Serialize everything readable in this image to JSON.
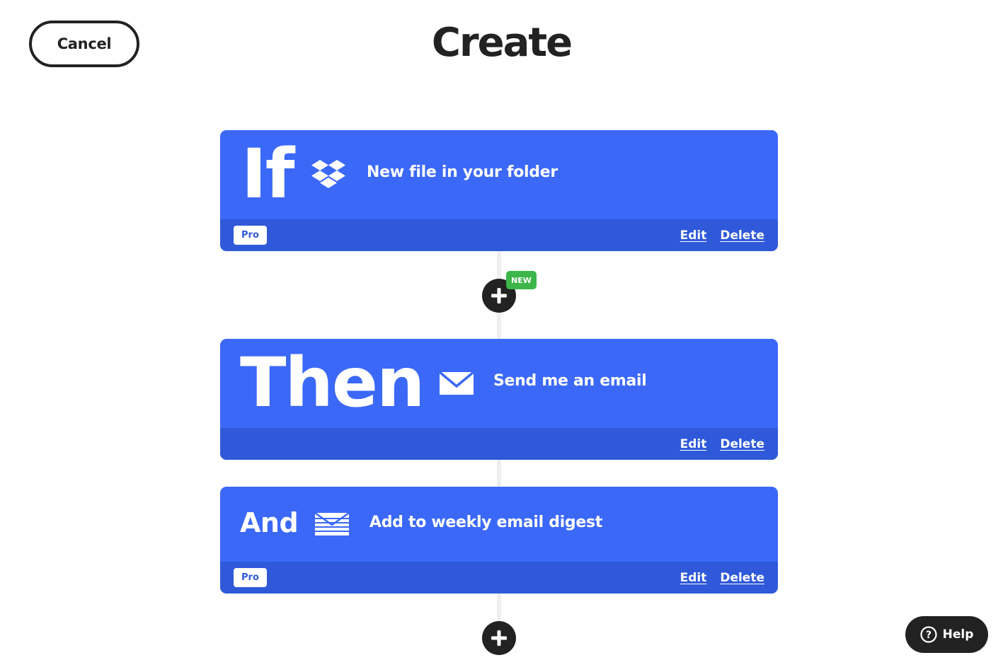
{
  "header": {
    "cancel_label": "Cancel",
    "title": "Create"
  },
  "steps": [
    {
      "keyword": "If",
      "icon": "dropbox-icon",
      "text": "New file in your folder",
      "badge": "Pro",
      "edit_label": "Edit",
      "delete_label": "Delete"
    },
    {
      "keyword": "Then",
      "icon": "envelope-icon",
      "text": "Send me an email",
      "badge": "",
      "edit_label": "Edit",
      "delete_label": "Delete"
    },
    {
      "keyword": "And",
      "icon": "email-digest-icon",
      "text": "Add to weekly email digest",
      "badge": "Pro",
      "edit_label": "Edit",
      "delete_label": "Delete"
    }
  ],
  "new_badge": "NEW",
  "help_label": "Help",
  "colors": {
    "card": "#3b68f7",
    "card_footer": "#2f59d9",
    "new_badge": "#3cb54a",
    "dark": "#222222"
  }
}
